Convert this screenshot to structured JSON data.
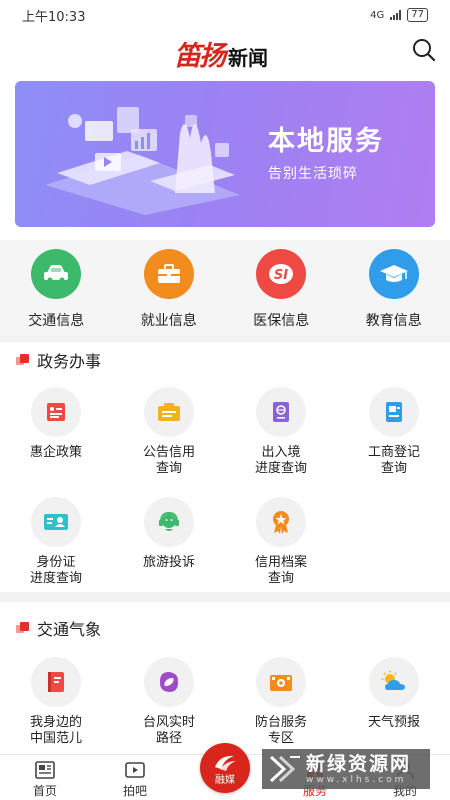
{
  "status_bar": {
    "time": "上午10:33",
    "network": "4G",
    "battery": "77"
  },
  "header": {
    "logo_brand": "笛扬",
    "logo_sub": "新闻"
  },
  "banner": {
    "title": "本地服务",
    "subtitle": "告别生活琐碎"
  },
  "quick_services": [
    {
      "label": "交通信息",
      "icon": "car-icon",
      "color": "#3cb96a"
    },
    {
      "label": "就业信息",
      "icon": "briefcase-icon",
      "color": "#f28c1f"
    },
    {
      "label": "医保信息",
      "icon": "social-insurance-icon",
      "color": "#ee4a43"
    },
    {
      "label": "教育信息",
      "icon": "graduation-cap-icon",
      "color": "#2f9de9"
    }
  ],
  "gov_section": {
    "title": "政务办事",
    "items": [
      {
        "label": "惠企政策",
        "icon": "policy-document-icon"
      },
      {
        "label": "公告信用\n查询",
        "icon": "announcement-icon"
      },
      {
        "label": "出入境\n进度查询",
        "icon": "passport-icon"
      },
      {
        "label": "工商登记\n查询",
        "icon": "business-register-icon"
      },
      {
        "label": "身份证\n进度查询",
        "icon": "id-card-icon"
      },
      {
        "label": "旅游投诉",
        "icon": "customer-service-icon"
      },
      {
        "label": "信用档案\n查询",
        "icon": "credit-badge-icon"
      }
    ]
  },
  "traffic_section": {
    "title": "交通气象",
    "items": [
      {
        "label": "我身边的\n中国范儿",
        "icon": "book-icon"
      },
      {
        "label": "台风实时\n路径",
        "icon": "typhoon-icon"
      },
      {
        "label": "防台服务\n专区",
        "icon": "shelter-icon"
      },
      {
        "label": "天气预报",
        "icon": "weather-icon"
      }
    ]
  },
  "tabbar": {
    "tabs": [
      {
        "label": "首页",
        "icon": "newspaper-icon"
      },
      {
        "label": "拍吧",
        "icon": "video-icon"
      },
      {
        "label": "融媒",
        "icon": "fusion-media-icon"
      },
      {
        "label": "服务",
        "icon": "service-icon"
      },
      {
        "label": "我的",
        "icon": "profile-icon"
      }
    ],
    "active": "服务",
    "accent": "#d9261c"
  },
  "watermark": {
    "text": "新绿资源网",
    "url": "www.xlhs.com"
  }
}
